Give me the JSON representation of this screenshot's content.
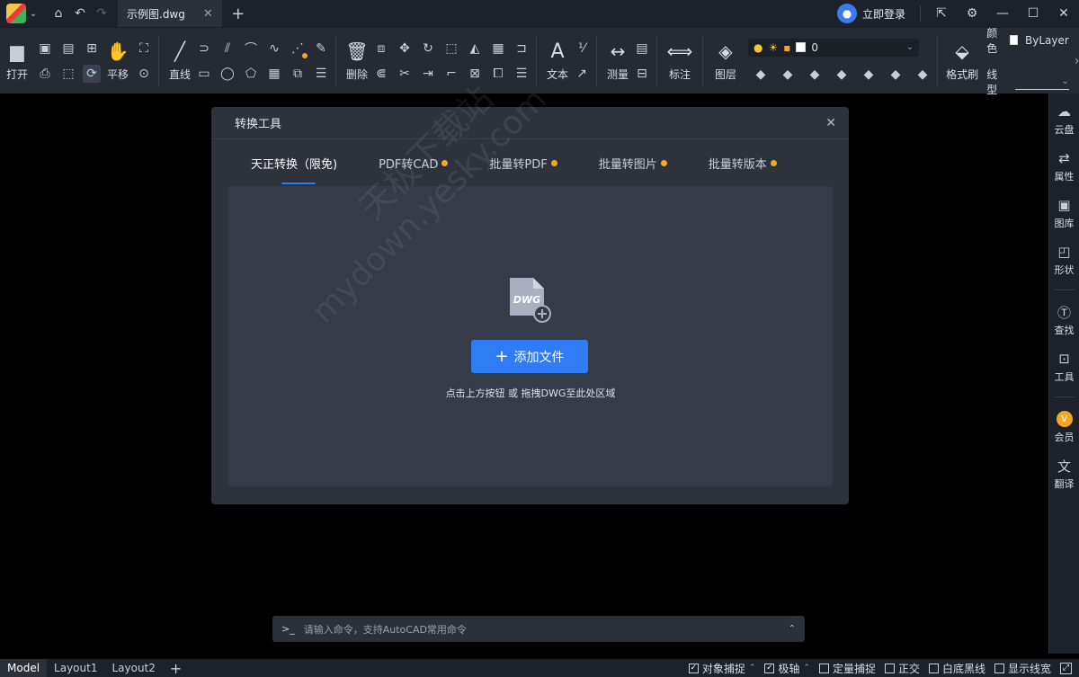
{
  "titlebar": {
    "tab_title": "示例图.dwg",
    "login_label": "立即登录"
  },
  "ribbon": {
    "open": "打开",
    "pan": "平移",
    "line": "直线",
    "delete": "删除",
    "text": "文本",
    "measure": "测量",
    "dimension": "标注",
    "layer": "图层",
    "layer_value": "0",
    "format_brush": "格式刷",
    "color_label": "颜色",
    "color_value": "ByLayer",
    "linetype_label": "线型"
  },
  "sidebar": {
    "items": [
      {
        "label": "云盘",
        "icon": "cloud-icon"
      },
      {
        "label": "属性",
        "icon": "properties-icon"
      },
      {
        "label": "图库",
        "icon": "gallery-icon"
      },
      {
        "label": "形状",
        "icon": "shape-icon"
      },
      {
        "label": "查找",
        "icon": "search-icon"
      },
      {
        "label": "工具",
        "icon": "toolbox-icon"
      },
      {
        "label": "会员",
        "icon": "vip-icon"
      },
      {
        "label": "翻译",
        "icon": "translate-icon"
      }
    ]
  },
  "dialog": {
    "title": "转换工具",
    "tabs": [
      {
        "label": "天正转换（限免)"
      },
      {
        "label": "PDF转CAD"
      },
      {
        "label": "批量转PDF"
      },
      {
        "label": "批量转图片"
      },
      {
        "label": "批量转版本"
      }
    ],
    "dwg_badge": "DWG",
    "add_file": "添加文件",
    "hint": "点击上方按钮 或  拖拽DWG至此处区域"
  },
  "watermark": {
    "line1": "天极下载站",
    "line2": "mydown.yesky.com"
  },
  "command": {
    "prompt": ">_",
    "placeholder": "请输入命令，支持AutoCAD常用命令"
  },
  "statusbar": {
    "tabs": [
      "Model",
      "Layout1",
      "Layout2"
    ],
    "options": [
      {
        "label": "对象捕捉",
        "checked": true
      },
      {
        "label": "极轴",
        "checked": true
      },
      {
        "label": "定量捕捉",
        "checked": false
      },
      {
        "label": "正交",
        "checked": false
      },
      {
        "label": "白底黑线",
        "checked": false
      },
      {
        "label": "显示线宽",
        "checked": false
      }
    ]
  },
  "colors": {
    "accent": "#2f7cf6",
    "badge_orange": "#f5a623",
    "canvas": "#000000",
    "dialog_bg": "#2d323d"
  }
}
